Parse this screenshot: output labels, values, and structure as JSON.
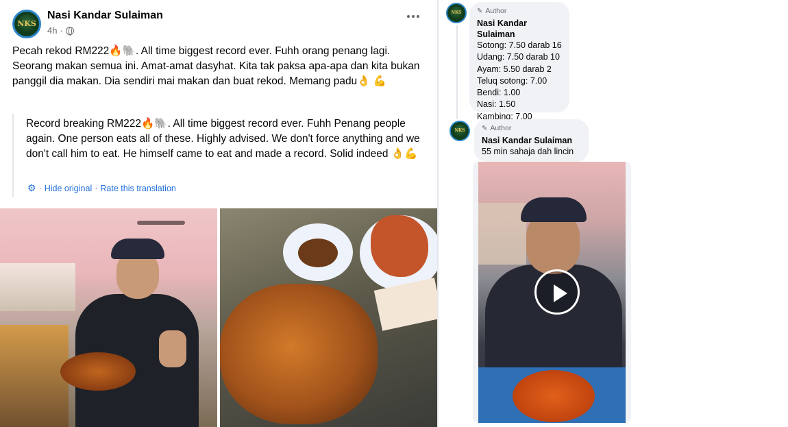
{
  "post": {
    "page_name": "Nasi Kandar Sulaiman",
    "avatar_text": "NKS",
    "timestamp": "4h",
    "meta_separator": "·",
    "original_text": "Pecah rekod RM222🔥🐘. All time biggest record ever. Fuhh orang penang lagi. Seorang makan semua ini. Amat-amat dasyhat. Kita tak paksa apa-apa dan kita bukan panggil dia makan. Dia sendiri mai makan dan buat rekod. Memang padu👌 💪",
    "translated_text": "Record breaking RM222🔥🐘. All time biggest record ever. Fuhh Penang people again. One person eats all of these. Highly advised. We don't force anything and we don't call him to eat. He himself came to eat and made a record. Solid indeed 👌💪",
    "hide_original_label": "Hide original",
    "rate_translation_label": "Rate this translation",
    "link_separator": "·"
  },
  "comments": [
    {
      "badge": "Author",
      "name": "Nasi Kandar Sulaiman",
      "avatar_text": "NKS",
      "lines": [
        "Sotong: 7.50 darab 16",
        "Udang: 7.50 darab 10",
        "Ayam: 5.50 darab 2",
        "Teluq sotong: 7.00",
        "Bendi: 1.00",
        "Nasi: 1.50",
        "Kambing: 7.00"
      ]
    },
    {
      "badge": "Author",
      "name": "Nasi Kandar Sulaiman",
      "avatar_text": "NKS",
      "lines": [
        "55 min sahaja dah lincin"
      ]
    }
  ],
  "icons": {
    "more": "more-dots-icon",
    "privacy": "globe-icon",
    "settings": "gear-icon",
    "author": "pencil-icon",
    "play": "play-icon"
  },
  "colors": {
    "link": "#216fdb",
    "secondary_text": "#65676b",
    "bubble": "#f0f2f5",
    "avatar_ring": "#2d86c9"
  }
}
